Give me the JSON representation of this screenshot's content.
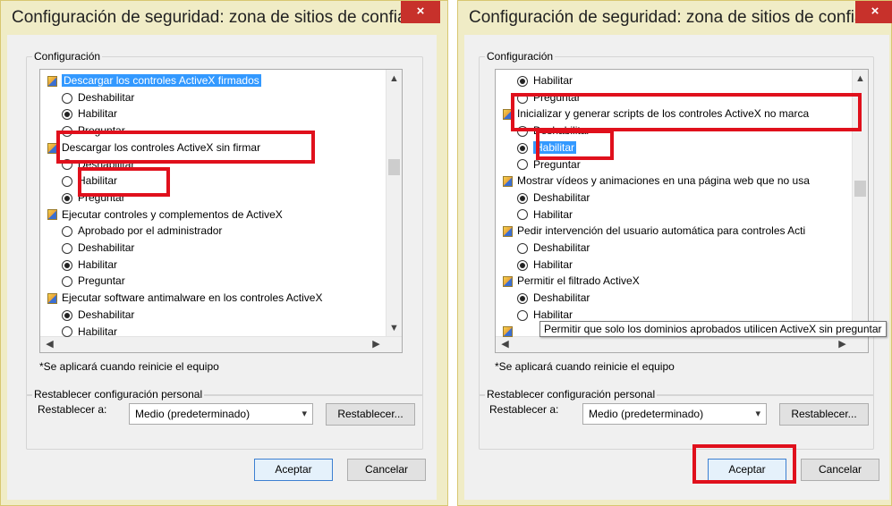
{
  "left": {
    "title": "Configuración de seguridad: zona de sitios de confianza",
    "close": "×",
    "settings_label": "Configuración",
    "list": [
      {
        "kind": "cat",
        "text": "Descargar los controles ActiveX firmados",
        "selected": true
      },
      {
        "kind": "opt",
        "text": "Deshabilitar",
        "checked": false
      },
      {
        "kind": "opt",
        "text": "Habilitar",
        "checked": true
      },
      {
        "kind": "opt",
        "text": "Preguntar",
        "checked": false
      },
      {
        "kind": "cat",
        "text": "Descargar los controles ActiveX sin firmar"
      },
      {
        "kind": "opt",
        "text": "Deshabilitar",
        "checked": false
      },
      {
        "kind": "opt",
        "text": "Habilitar",
        "checked": false
      },
      {
        "kind": "opt",
        "text": "Preguntar",
        "checked": true
      },
      {
        "kind": "cat",
        "text": "Ejecutar controles y complementos de ActiveX"
      },
      {
        "kind": "opt",
        "text": "Aprobado por el administrador",
        "checked": false
      },
      {
        "kind": "opt",
        "text": "Deshabilitar",
        "checked": false
      },
      {
        "kind": "opt",
        "text": "Habilitar",
        "checked": true
      },
      {
        "kind": "opt",
        "text": "Preguntar",
        "checked": false
      },
      {
        "kind": "cat",
        "text": "Ejecutar software antimalware en los controles ActiveX"
      },
      {
        "kind": "opt",
        "text": "Deshabilitar",
        "checked": true
      },
      {
        "kind": "opt",
        "text": "Habilitar",
        "checked": false
      }
    ],
    "note": "*Se aplicará cuando reinicie el equipo",
    "reset_group": "Restablecer configuración personal",
    "reset_to": "Restablecer a:",
    "reset_value": "Medio (predeterminado)",
    "reset_button": "Restablecer...",
    "ok": "Aceptar",
    "cancel": "Cancelar"
  },
  "right": {
    "title": "Configuración de seguridad: zona de sitios de confianza",
    "close": "×",
    "settings_label": "Configuración",
    "list": [
      {
        "kind": "opt",
        "text": "Habilitar",
        "checked": true
      },
      {
        "kind": "opt",
        "text": "Preguntar",
        "checked": false
      },
      {
        "kind": "cat",
        "text": "Inicializar y generar scripts de los controles ActiveX no marca"
      },
      {
        "kind": "opt",
        "text": "Deshabilitar",
        "checked": false
      },
      {
        "kind": "opt",
        "text": "Habilitar",
        "checked": true,
        "selected": true
      },
      {
        "kind": "opt",
        "text": "Preguntar",
        "checked": false
      },
      {
        "kind": "cat",
        "text": "Mostrar vídeos y animaciones en una página web que no usa"
      },
      {
        "kind": "opt",
        "text": "Deshabilitar",
        "checked": true
      },
      {
        "kind": "opt",
        "text": "Habilitar",
        "checked": false
      },
      {
        "kind": "cat",
        "text": "Pedir intervención del usuario automática para controles Acti"
      },
      {
        "kind": "opt",
        "text": "Deshabilitar",
        "checked": false
      },
      {
        "kind": "opt",
        "text": "Habilitar",
        "checked": true
      },
      {
        "kind": "cat",
        "text": "Permitir el filtrado ActiveX"
      },
      {
        "kind": "opt",
        "text": "Deshabilitar",
        "checked": true
      },
      {
        "kind": "opt",
        "text": "Habilitar",
        "checked": false
      },
      {
        "kind": "cat",
        "text": ""
      }
    ],
    "tooltip": "Permitir que solo los dominios aprobados utilicen ActiveX sin preguntar",
    "note": "*Se aplicará cuando reinicie el equipo",
    "reset_group": "Restablecer configuración personal",
    "reset_to": "Restablecer a:",
    "reset_value": "Medio (predeterminado)",
    "reset_button": "Restablecer...",
    "ok": "Aceptar",
    "cancel": "Cancelar"
  },
  "colors": {
    "highlight": "#e0101c",
    "selection": "#3399ff",
    "title_bar": "#f0ecc6",
    "close_button": "#c7312b"
  }
}
